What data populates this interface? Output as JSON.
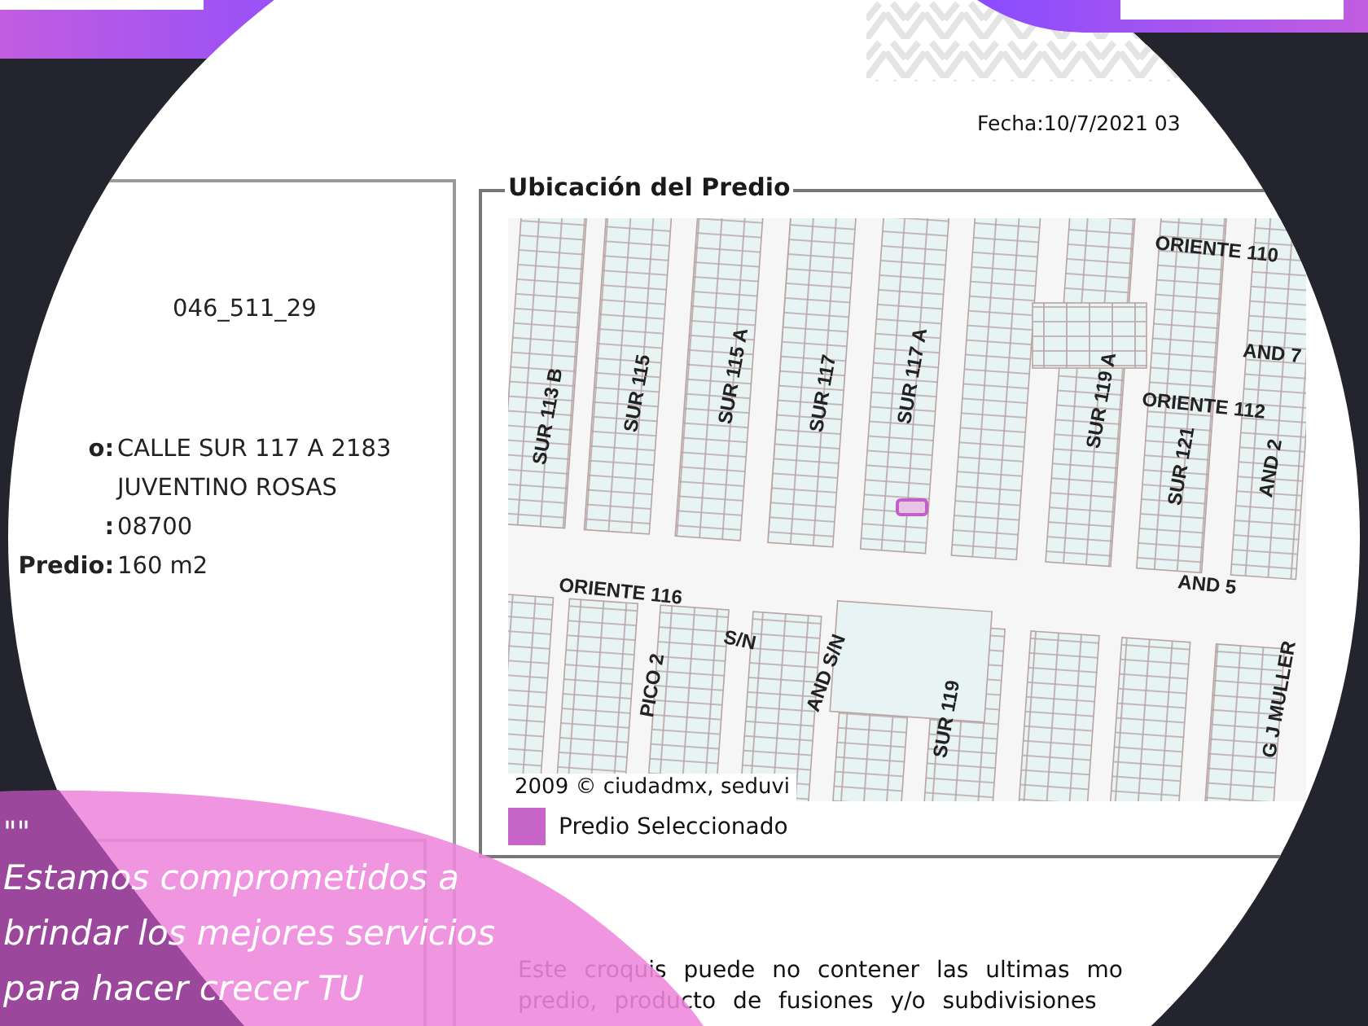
{
  "document": {
    "date": "Fecha:10/7/2021 03",
    "left_panel": {
      "account": "046_511_29",
      "fields": [
        {
          "label": "o:",
          "value": "CALLE SUR 117 A 2183"
        },
        {
          "value": "JUVENTINO ROSAS"
        },
        {
          "label": ":",
          "value": "08700"
        },
        {
          "label": "Predio:",
          "value": "160 m2"
        }
      ]
    },
    "map_section": {
      "title": "Ubicación del Predio",
      "street_labels": [
        "ORIENTE 110",
        "AND 7",
        "ORIENTE 112",
        "SUR 113 B",
        "SUR 115",
        "SUR 115 A",
        "SUR 117",
        "SUR 117 A",
        "SUR 119 A",
        "SUR 121",
        "AND 2",
        "ORIENTE 116",
        "S/N",
        "AND 5",
        "PICO 2",
        "AND S/N",
        "SUR 119",
        "G J MULLER"
      ],
      "attribution": "2009 © ciudadmx, seduvi",
      "legend": "Predio Seleccionado"
    },
    "note_lines": [
      "Este croquis puede no contener las ultimas mo",
      "predio, producto de fusiones y/o subdivisiones"
    ]
  },
  "quote": {
    "mark": "\"\"",
    "lines": [
      "Estamos comprometidos a",
      "brindar los mejores servicios",
      "para hacer crecer TU"
    ]
  }
}
